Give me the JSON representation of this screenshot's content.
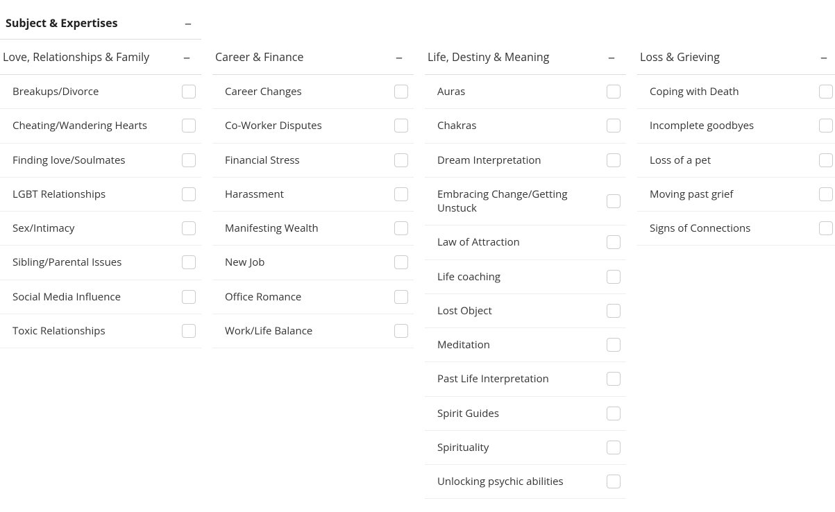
{
  "main_header": "Subject & Expertises",
  "minus": "–",
  "columns": [
    {
      "title": "Love, Relationships & Family",
      "items": [
        "Breakups/Divorce",
        "Cheating/Wandering Hearts",
        "Finding love/Soulmates",
        "LGBT Relationships",
        "Sex/Intimacy",
        "Sibling/Parental Issues",
        "Social Media Influence",
        "Toxic Relationships"
      ]
    },
    {
      "title": "Career & Finance",
      "items": [
        "Career Changes",
        "Co-Worker Disputes",
        "Financial Stress",
        "Harassment",
        "Manifesting Wealth",
        "New Job",
        "Office Romance",
        "Work/Life Balance"
      ]
    },
    {
      "title": "Life, Destiny & Meaning",
      "items": [
        "Auras",
        "Chakras",
        "Dream Interpretation",
        "Embracing Change/Getting Unstuck",
        "Law of Attraction",
        "Life coaching",
        "Lost Object",
        "Meditation",
        "Past Life Interpretation",
        "Spirit Guides",
        "Spirituality",
        "Unlocking psychic abilities"
      ]
    },
    {
      "title": "Loss & Grieving",
      "items": [
        "Coping with Death",
        "Incomplete goodbyes",
        "Loss of a pet",
        "Moving past grief",
        "Signs of Connections"
      ]
    }
  ]
}
